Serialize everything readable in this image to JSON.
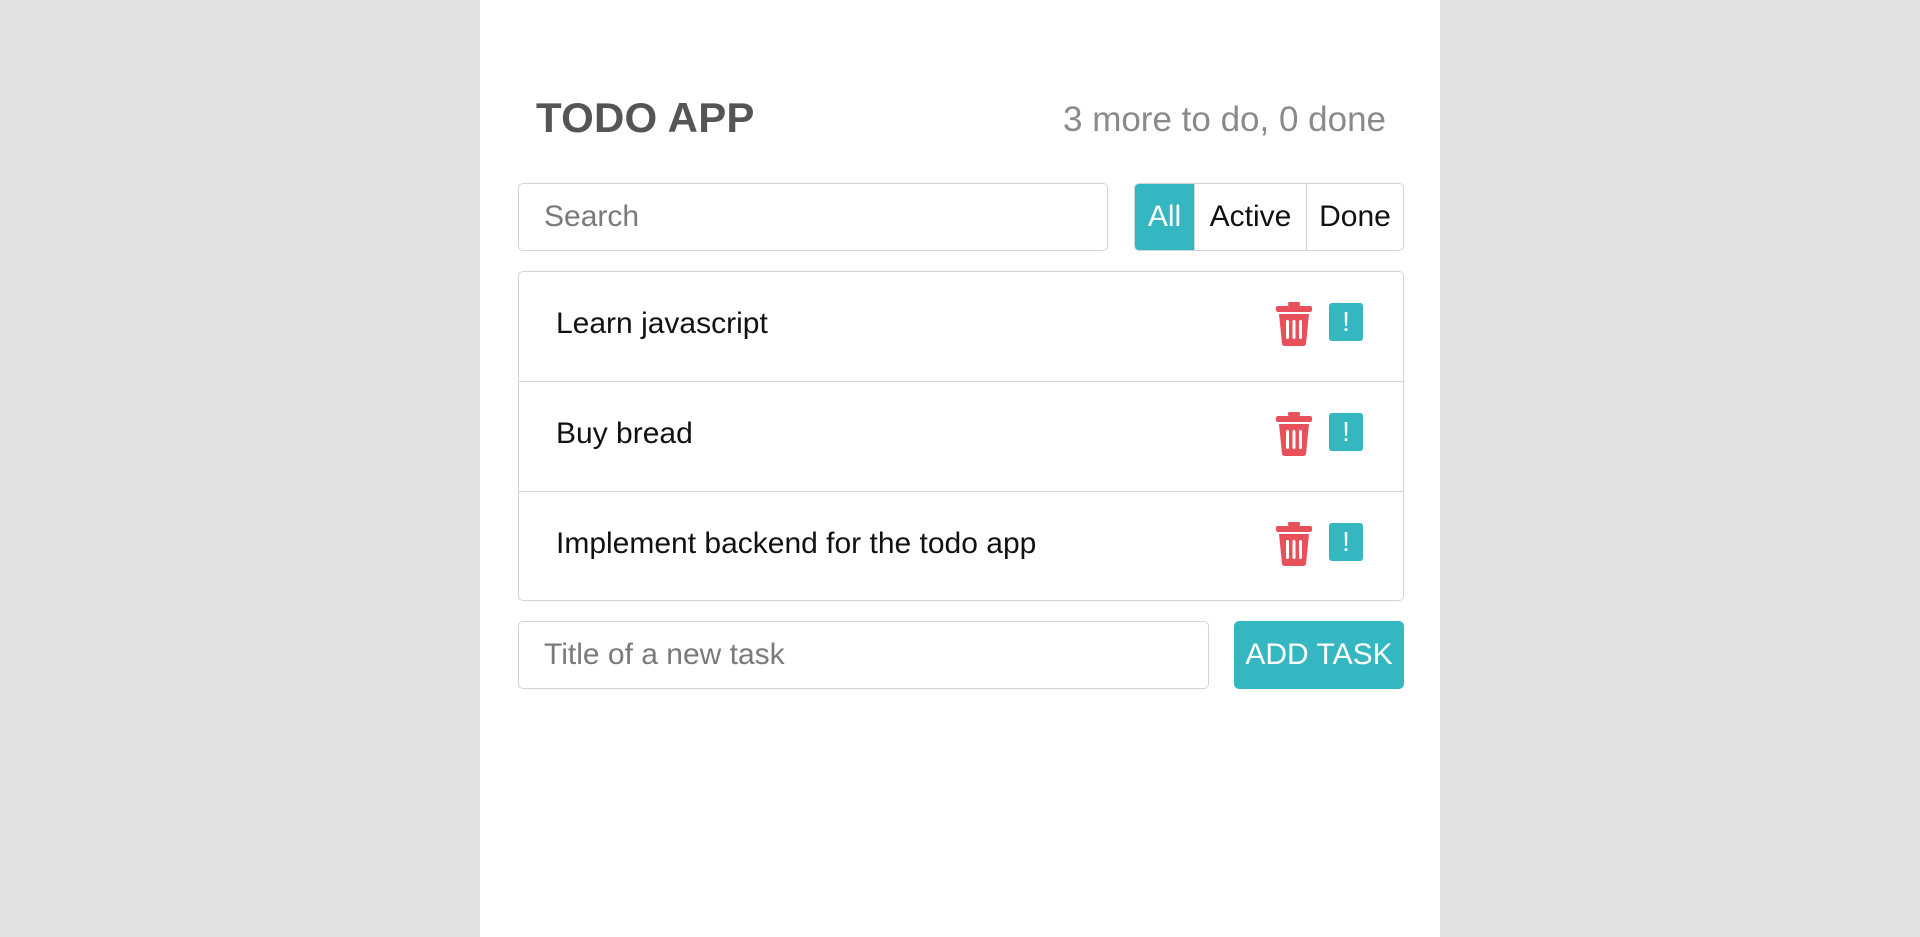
{
  "header": {
    "title": "TODO APP",
    "counter": "3 more to do, 0 done"
  },
  "search": {
    "placeholder": "Search",
    "value": ""
  },
  "filters": [
    {
      "label": "All",
      "active": true
    },
    {
      "label": "Active",
      "active": false
    },
    {
      "label": "Done",
      "active": false
    }
  ],
  "todos": [
    {
      "label": "Learn javascript",
      "delete_icon": "trash-icon",
      "important_label": "!"
    },
    {
      "label": "Buy bread",
      "delete_icon": "trash-icon",
      "important_label": "!"
    },
    {
      "label": "Implement backend for the todo app",
      "delete_icon": "trash-icon",
      "important_label": "!"
    }
  ],
  "add_task": {
    "placeholder": "Title of a new task",
    "value": "",
    "button_label": "ADD TASK"
  },
  "colors": {
    "accent": "#35b7c1",
    "danger": "#e8505b",
    "background": "#e1e1e1",
    "panel": "#ffffff"
  }
}
